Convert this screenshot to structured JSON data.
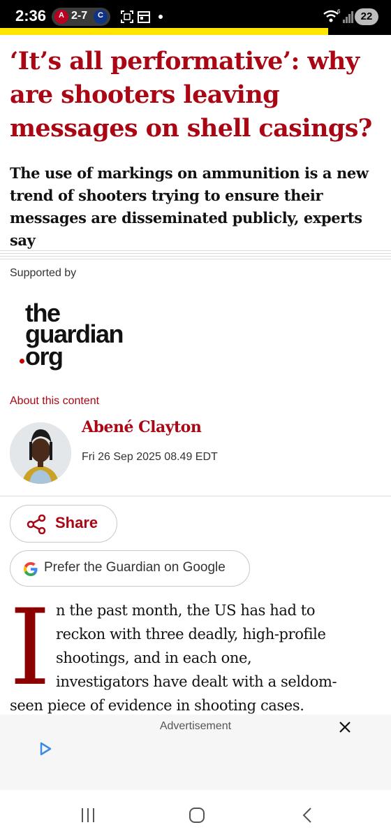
{
  "status_bar": {
    "time": "2:36",
    "score": "2-7",
    "battery": "22",
    "icons": [
      "angels-logo-icon",
      "cubs-logo-icon",
      "screenshot-icon",
      "calendar-icon",
      "notification-dot-icon",
      "wifi-icon",
      "signal-icon",
      "battery-icon"
    ]
  },
  "article": {
    "headline": "‘It’s all performative’: why are shooters leaving messages on shell casings?",
    "standfirst": "The use of markings on ammunition is a new trend of shooters trying to ensure their messages are disseminated publicly, experts say",
    "supported_by": "Supported by",
    "sponsor_logo": {
      "line1": "the",
      "line2": "guardian",
      "line3": "org"
    },
    "about_link": "About this content",
    "author": "Abené Clayton",
    "date": "Fri 26 Sep 2025 08.49 EDT",
    "share_label": "Share",
    "google_label": "Prefer the Guardian on Google",
    "dropcap": "I",
    "body_lines": [
      "n the past month, the US has had to",
      "reckon with three deadly, high-profile",
      "shootings, and in each one,",
      "investigators have dealt with a seldom-",
      "seen piece of evidence in shooting cases."
    ]
  },
  "ad": {
    "label": "Advertisement",
    "icons": [
      "close-icon",
      "play-icon"
    ]
  },
  "nav": {
    "icons": [
      "recents-icon",
      "home-icon",
      "back-icon"
    ]
  },
  "colors": {
    "headline_red": "#ab0613",
    "highlight_yellow": "#ffe500",
    "dropcap_red": "#8b0000"
  }
}
